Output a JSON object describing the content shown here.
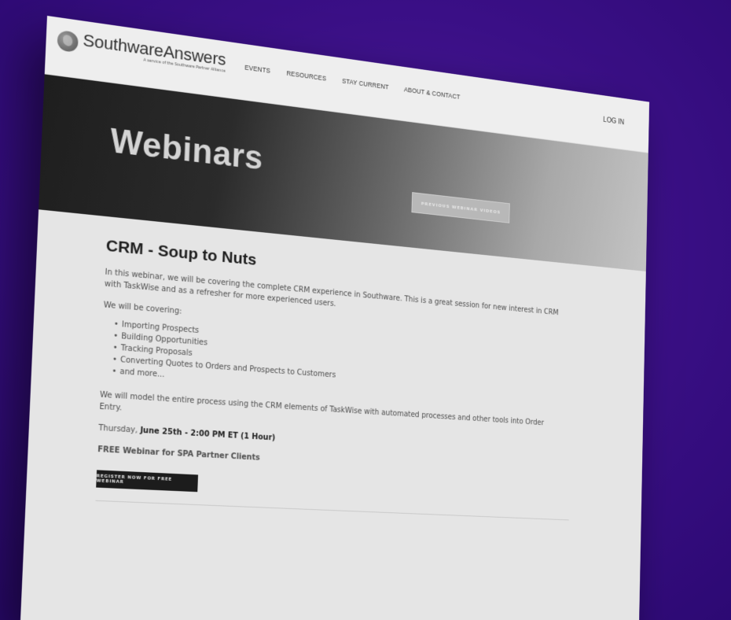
{
  "header": {
    "logo_name": "SouthwareAnswers",
    "logo_tagline": "A service of the Southware Partner Alliance",
    "nav": [
      {
        "label": "EVENTS"
      },
      {
        "label": "RESOURCES"
      },
      {
        "label": "STAY CURRENT"
      },
      {
        "label": "ABOUT & CONTACT"
      }
    ],
    "login_label": "LOG IN"
  },
  "hero": {
    "title": "Webinars",
    "previous_button": "PREVIOUS WEBINAR VIDEOS"
  },
  "article": {
    "title": "CRM - Soup to Nuts",
    "intro": "In this webinar, we will be covering the complete CRM experience in Southware.  This is a great session for new interest in CRM with TaskWise and as a refresher for more experienced users.",
    "covering_label": "We will be covering:",
    "topics": [
      "Importing Prospects",
      "Building Opportunities",
      "Tracking Proposals",
      "Converting Quotes to Orders and Prospects to Customers",
      "and more..."
    ],
    "model_text": "We will model the entire process using the CRM elements of TaskWise with automated processes and other tools into Order Entry.",
    "day": "Thursday,",
    "date_time": "June 25th - 2:00 PM ET (1 Hour)",
    "free_line": "FREE Webinar for SPA Partner Clients",
    "register_button": "REGISTER NOW FOR FREE WEBINAR"
  },
  "colors": {
    "page_background": "#3a0f86",
    "screen_background": "#e5e5e5",
    "hero_dark": "#1e1e1e",
    "button_dark": "#1c1c1c"
  }
}
